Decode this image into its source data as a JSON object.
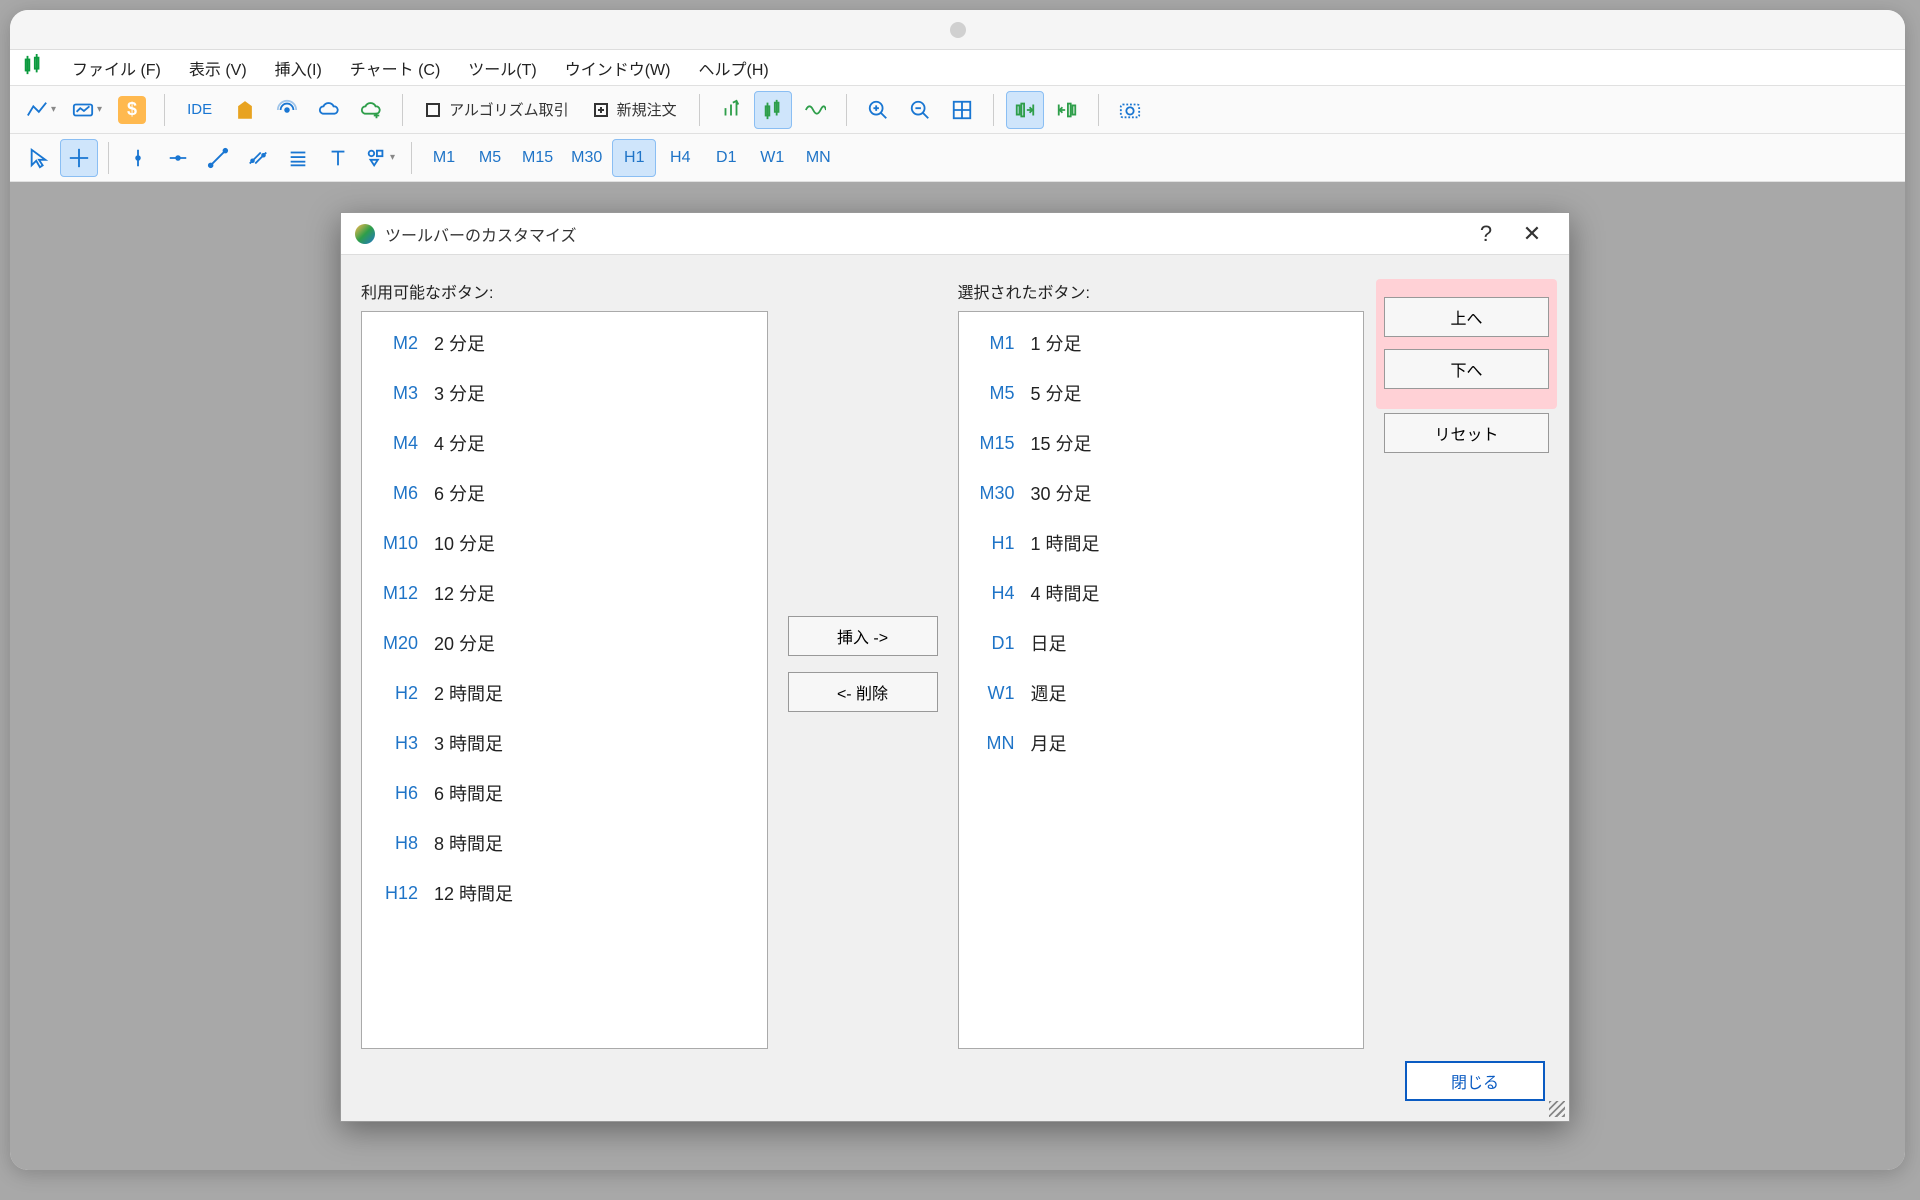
{
  "menu": {
    "file": "ファイル (F)",
    "view": "表示 (V)",
    "insert": "挿入(I)",
    "chart": "チャート (C)",
    "tool": "ツール(T)",
    "window": "ウインドウ(W)",
    "help": "ヘルプ(H)"
  },
  "toolbar": {
    "ide": "IDE",
    "algo": "アルゴリズム取引",
    "new_order": "新規注文"
  },
  "timeframes": [
    "M1",
    "M5",
    "M15",
    "M30",
    "H1",
    "H4",
    "D1",
    "W1",
    "MN"
  ],
  "active_timeframe": "H1",
  "dialog": {
    "title": "ツールバーのカスタマイズ",
    "available_label": "利用可能なボタン:",
    "selected_label": "選択されたボタン:",
    "insert_btn": "挿入 ->",
    "remove_btn": "<- 削除",
    "up_btn": "上へ",
    "down_btn": "下へ",
    "reset_btn": "リセット",
    "close_btn": "閉じる"
  },
  "available": [
    {
      "code": "M2",
      "label": "2 分足"
    },
    {
      "code": "M3",
      "label": "3 分足"
    },
    {
      "code": "M4",
      "label": "4 分足"
    },
    {
      "code": "M6",
      "label": "6 分足"
    },
    {
      "code": "M10",
      "label": "10 分足"
    },
    {
      "code": "M12",
      "label": "12 分足"
    },
    {
      "code": "M20",
      "label": "20 分足"
    },
    {
      "code": "H2",
      "label": "2 時間足"
    },
    {
      "code": "H3",
      "label": "3 時間足"
    },
    {
      "code": "H6",
      "label": "6 時間足"
    },
    {
      "code": "H8",
      "label": "8 時間足"
    },
    {
      "code": "H12",
      "label": "12 時間足"
    }
  ],
  "selected": [
    {
      "code": "M1",
      "label": "1 分足"
    },
    {
      "code": "M5",
      "label": "5 分足"
    },
    {
      "code": "M15",
      "label": "15 分足"
    },
    {
      "code": "M30",
      "label": "30 分足"
    },
    {
      "code": "H1",
      "label": "1 時間足"
    },
    {
      "code": "H4",
      "label": "4 時間足"
    },
    {
      "code": "D1",
      "label": "日足"
    },
    {
      "code": "W1",
      "label": "週足"
    },
    {
      "code": "MN",
      "label": "月足"
    }
  ]
}
